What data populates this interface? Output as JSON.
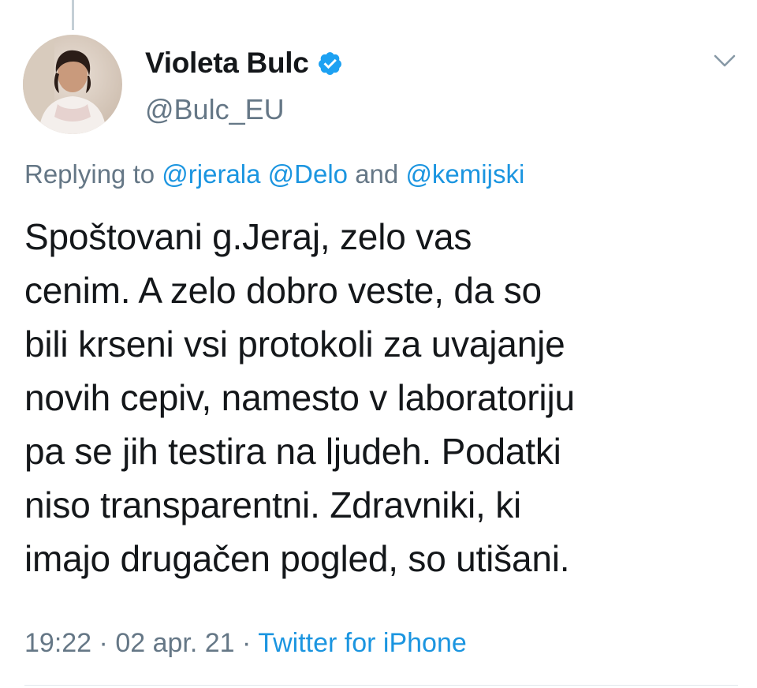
{
  "author": {
    "display_name": "Violeta Bulc",
    "handle": "@Bulc_EU",
    "verified": true,
    "avatar_icon": "profile-photo"
  },
  "reply": {
    "prefix": "Replying to",
    "mentions": [
      "@rjerala",
      "@Delo",
      "@kemijski"
    ],
    "conjunction": "and"
  },
  "tweet": {
    "lines": [
      "Spoštovani g.Jeraj, zelo vas",
      "cenim. A zelo dobro veste, da so",
      "bili krseni vsi protokoli za uvajanje",
      "novih cepiv, namesto v laboratoriju",
      "pa se jih testira na ljudeh. Podatki",
      "niso transparentni. Zdravniki, ki",
      "imajo drugačen  pogled, so utišani."
    ]
  },
  "meta": {
    "time": "19:22",
    "separator": "·",
    "date": "02 apr. 21",
    "source": "Twitter for iPhone"
  },
  "colors": {
    "link": "#1b95e0",
    "secondary_text": "#657786",
    "primary_text": "#14171a",
    "verified_badge": "#1da1f2"
  }
}
